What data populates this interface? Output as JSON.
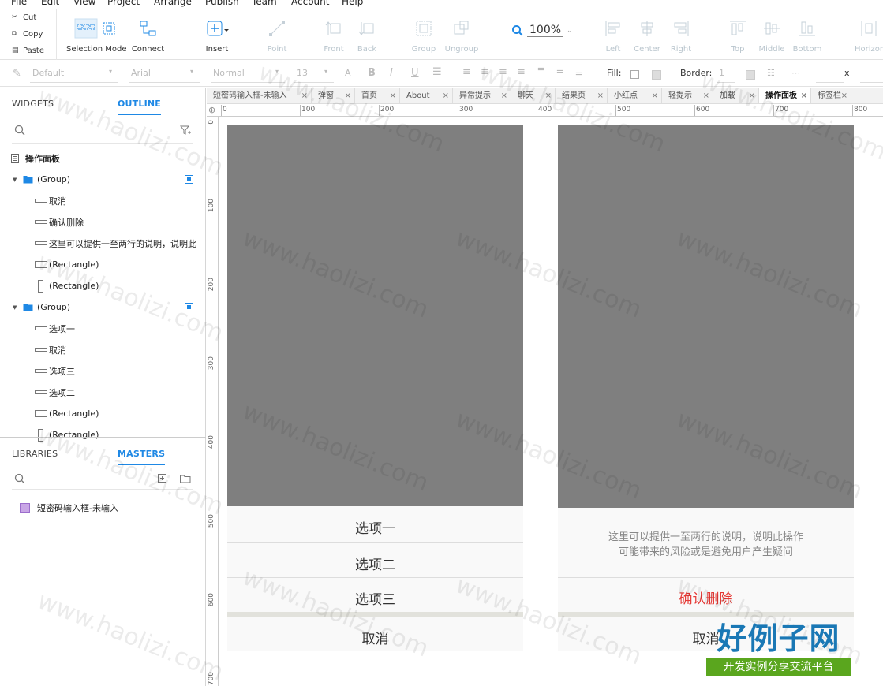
{
  "menu": [
    "File",
    "Edit",
    "View",
    "Project",
    "Arrange",
    "Publish",
    "Team",
    "Account",
    "Help"
  ],
  "clipboard": {
    "cut": "Cut",
    "copy": "Copy",
    "paste": "Paste"
  },
  "toolbar": {
    "selection_mode": "Selection Mode",
    "connect": "Connect",
    "insert": "Insert",
    "point": "Point",
    "front": "Front",
    "back": "Back",
    "group": "Group",
    "ungroup": "Ungroup",
    "zoom": "100%",
    "left": "Left",
    "center": "Center",
    "right": "Right",
    "top": "Top",
    "middle": "Middle",
    "bottom": "Bottom",
    "horizontal": "Horizon"
  },
  "format": {
    "style": "Default",
    "font": "Arial",
    "weight": "Normal",
    "size": "13",
    "fill_label": "Fill:",
    "border_label": "Border:",
    "border_value": "1",
    "x_label": "x"
  },
  "left_panel": {
    "tab_widgets": "WIDGETS",
    "tab_outline": "OUTLINE",
    "page_title": "操作面板",
    "outline": [
      {
        "label": "(Group)",
        "type": "group"
      },
      {
        "label": "取消",
        "type": "rect"
      },
      {
        "label": "确认删除",
        "type": "rect"
      },
      {
        "label": "这里可以提供一至两行的说明，说明此",
        "type": "rect"
      },
      {
        "label": "(Rectangle)",
        "type": "rect-h"
      },
      {
        "label": "(Rectangle)",
        "type": "rect-v"
      },
      {
        "label": "(Group)",
        "type": "group"
      },
      {
        "label": "选项一",
        "type": "rect"
      },
      {
        "label": "取消",
        "type": "rect"
      },
      {
        "label": "选项三",
        "type": "rect"
      },
      {
        "label": "选项二",
        "type": "rect"
      },
      {
        "label": "(Rectangle)",
        "type": "rect-h"
      },
      {
        "label": "(Rectangle)",
        "type": "rect-v"
      }
    ],
    "tab_libraries": "LIBRARIES",
    "tab_masters": "MASTERS",
    "master_item": "短密码输入框-未输入"
  },
  "doc_tabs": [
    "短密码输入框-未输入",
    "弹窗",
    "首页",
    "About",
    "异常提示",
    "聊天",
    "结果页",
    "小红点",
    "轻提示",
    "加载",
    "操作面板",
    "标签栏"
  ],
  "active_doc_tab": "操作面板",
  "ruler_h": [
    "0",
    "100",
    "200",
    "300",
    "400",
    "500",
    "600",
    "700",
    "800"
  ],
  "ruler_v": [
    "0",
    "100",
    "200",
    "300",
    "400",
    "500",
    "600",
    "700"
  ],
  "canvas": {
    "left_sheet": {
      "options": [
        "选项一",
        "选项二",
        "选项三"
      ],
      "cancel": "取消"
    },
    "right_sheet": {
      "description_line1": "这里可以提供一至两行的说明，说明此操作",
      "description_line2": "可能带来的风险或是避免用户产生疑问",
      "confirm": "确认删除",
      "cancel": "取消",
      "confirm_color": "#e53935"
    }
  },
  "watermark": "www.haolizi.com",
  "brand": {
    "title": "好例子网",
    "subtitle": "开发实例分享交流平台"
  }
}
